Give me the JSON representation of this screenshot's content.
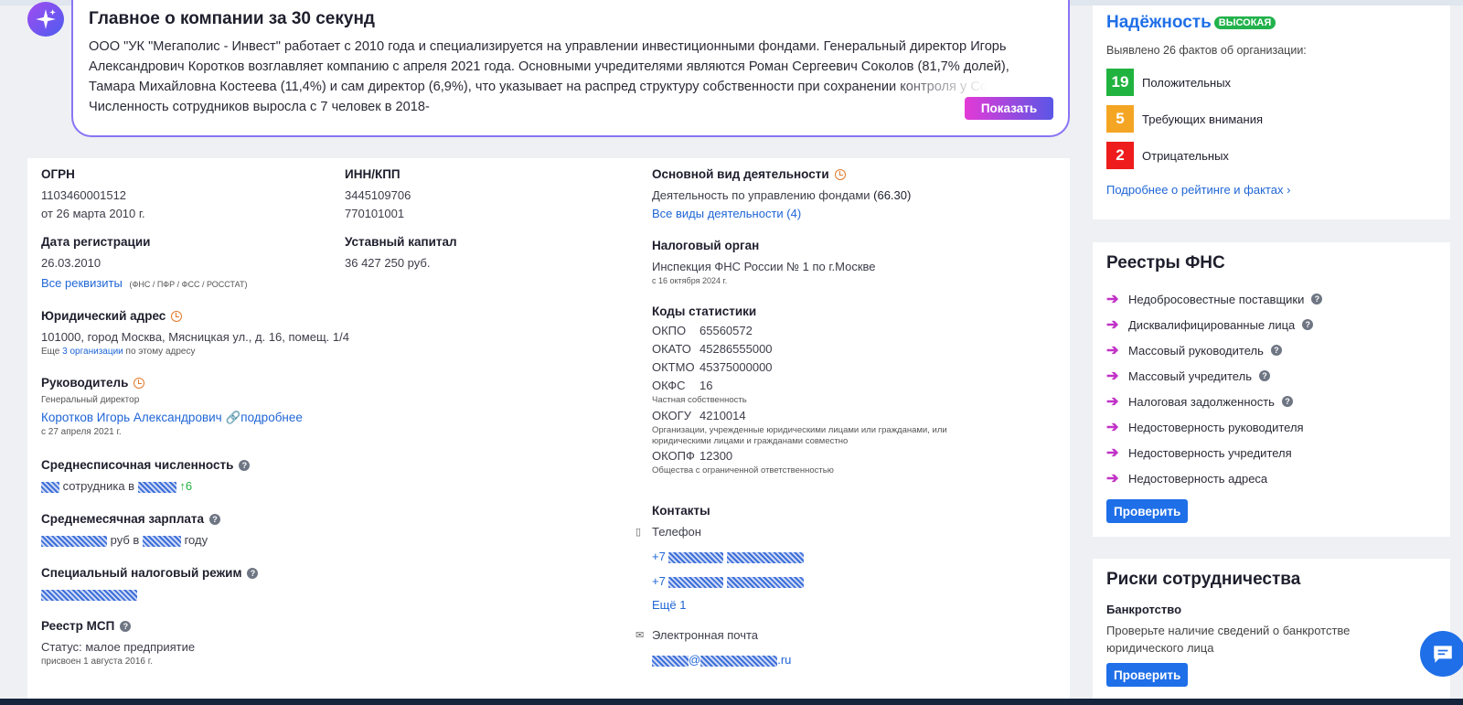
{
  "summary": {
    "title": "Главное о компании за 30 секунд",
    "text": "ООО \"УК \"Мегаполис - Инвест\" работает с 2010 года и специализируется на управлении инвестиционными фондами. Генеральный директор Игорь Александрович Коротков возглавляет компанию с апреля 2021 года. Основными учредителями являются Роман Сергеевич Соколов (81,7% долей), Тамара Михайловна Костеева (11,4%) и сам директор (6,9%), что указывает на распред структуру собственности при сохранении контроля у Соколова. Численность сотрудников выросла с 7 человек в 2018-",
    "show_label": "Показать"
  },
  "ogrn": {
    "label": "ОГРН",
    "value": "1103460001512",
    "date": "от 26 марта 2010 г."
  },
  "inn": {
    "label": "ИНН/КПП",
    "inn": "3445109706",
    "kpp": "770101001"
  },
  "reg_date": {
    "label": "Дата регистрации",
    "value": "26.03.2010",
    "all_requisites": "Все реквизиты",
    "requisites_note": "(ФНС / ПФР / ФСС / РОССТАТ)"
  },
  "capital": {
    "label": "Уставный капитал",
    "value": "36 427 250 руб."
  },
  "address": {
    "label": "Юридический адрес",
    "value": "101000, город Москва, Мясницкая ул., д. 16, помещ. 1/4",
    "more_prefix": "Еще",
    "more_link": "3 организации",
    "more_suffix": "по этому адресу"
  },
  "head": {
    "label": "Руководитель",
    "role": "Генеральный директор",
    "name": "Коротков Игорь Александрович",
    "details": "подробнее",
    "since": "с 27 апреля 2021 г."
  },
  "headcount": {
    "label": "Среднесписочная численность",
    "text1": "сотрудника в",
    "delta": "↑6"
  },
  "salary": {
    "label": "Среднемесячная зарплата",
    "text1": "руб в",
    "text2": "году"
  },
  "tax_regime": {
    "label": "Специальный налоговый режим"
  },
  "msp": {
    "label": "Реестр МСП",
    "status": "Статус: малое предприятие",
    "assigned": "присвоен 1 августа 2016 г."
  },
  "activity": {
    "label": "Основной вид деятельности",
    "value": "Деятельность по управлению фондами",
    "code": "(66.30)",
    "all_link": "Все виды деятельности (4)"
  },
  "tax_office": {
    "label": "Налоговый орган",
    "value": "Инспекция ФНС России № 1 по г.Москве",
    "since": "с 16 октября 2024 г."
  },
  "stat_codes": {
    "label": "Коды статистики",
    "okpo_k": "ОКПО",
    "okpo_v": "65560572",
    "okato_k": "ОКАТО",
    "okato_v": "45286555000",
    "oktmo_k": "ОКТМО",
    "oktmo_v": "45375000000",
    "okfs_k": "ОКФС",
    "okfs_v": "16",
    "okfs_note": "Частная собственность",
    "okogu_k": "ОКОГУ",
    "okogu_v": "4210014",
    "okogu_note": "Организации, учрежденные юридическими лицами или гражданами, или юридическими лицами и гражданами совместно",
    "okopf_k": "ОКОПФ",
    "okopf_v": "12300",
    "okopf_note": "Общества с ограниченной ответственностью"
  },
  "contacts": {
    "label": "Контакты",
    "phone_label": "Телефон",
    "phone_prefix": "+7",
    "more": "Ещё 1",
    "email_label": "Электронная почта",
    "email_at": "@",
    "email_tld": ".ru"
  },
  "reliability": {
    "title": "Надёжность",
    "badge": "ВЫСОКАЯ",
    "found": "Выявлено 26 фактов об организации:",
    "positive_n": "19",
    "positive": "Положительных",
    "attention_n": "5",
    "attention": "Требующих внимания",
    "negative_n": "2",
    "negative": "Отрицательных",
    "more_link": "Подробнее о рейтинге и фактах",
    "colors": {
      "positive": "#21b33f",
      "attention": "#f5a524",
      "negative": "#ee1c1c"
    }
  },
  "fns": {
    "title": "Реестры ФНС",
    "items": [
      "Недобросовестные поставщики",
      "Дисквалифицированные лица",
      "Массовый руководитель",
      "Массовый учредитель",
      "Налоговая задолженность",
      "Недостоверность руководителя",
      "Недостоверность учредителя",
      "Недостоверность адреса"
    ],
    "check": "Проверить"
  },
  "risks": {
    "title": "Риски сотрудничества",
    "bankrupt_label": "Банкротство",
    "bankrupt_text": "Проверьте наличие сведений о банкротстве юридического лица",
    "check": "Проверить"
  }
}
